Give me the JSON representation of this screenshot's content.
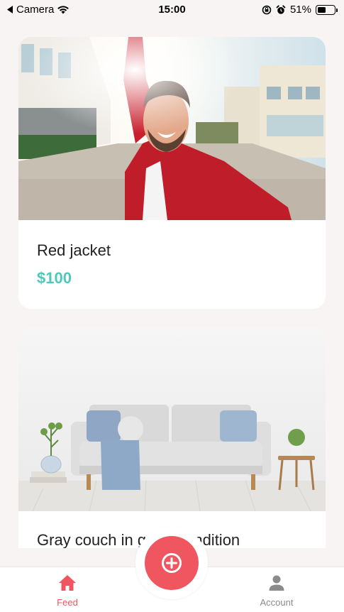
{
  "status_bar": {
    "back_app": "Camera",
    "time": "15:00",
    "battery": "51%",
    "battery_level": 0.51
  },
  "feed": {
    "items": [
      {
        "title": "Red jacket",
        "price": "$100",
        "image": "man-in-red-jacket-selfie-photo"
      },
      {
        "title": "Gray couch in great condition",
        "image": "gray-couch-living-room-photo"
      }
    ]
  },
  "tab_bar": {
    "feed_label": "Feed",
    "account_label": "Account",
    "add_icon": "plus-icon",
    "active_color": "#f0565f",
    "inactive_color": "#8b8b8b"
  },
  "colors": {
    "accent": "#f0565f",
    "price": "#4ec9b8",
    "background": "#f8f4f4"
  }
}
